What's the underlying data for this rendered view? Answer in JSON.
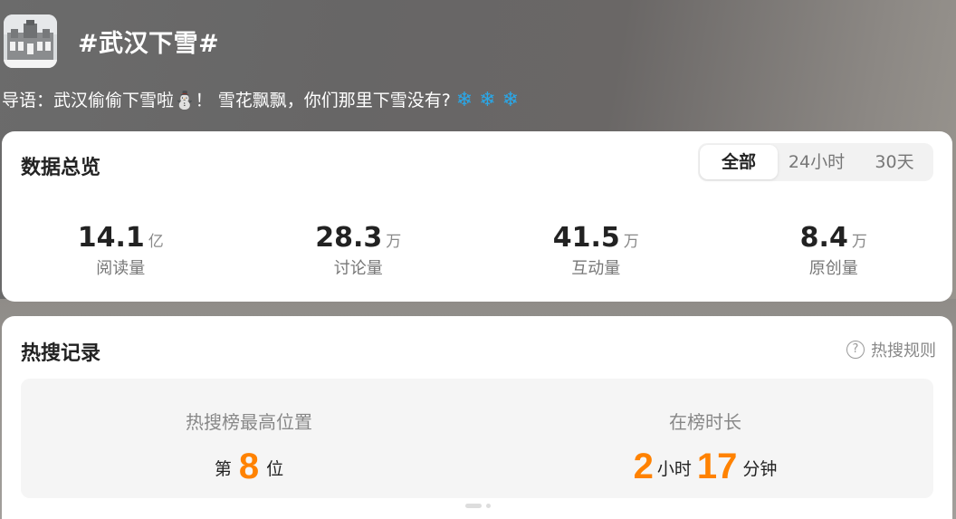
{
  "topic": {
    "title": "#武汉下雪#",
    "intro": "导语：武汉偷偷下雪啦⛄！ 雪花飘飘，你们那里下雪没有?",
    "snowflakes": "❄ ❄ ❄"
  },
  "overview": {
    "title": "数据总览",
    "tabs": [
      {
        "label": "全部",
        "active": true
      },
      {
        "label": "24小时",
        "active": false
      },
      {
        "label": "30天",
        "active": false
      }
    ],
    "stats": [
      {
        "value": "14.1",
        "unit": "亿",
        "label": "阅读量"
      },
      {
        "value": "28.3",
        "unit": "万",
        "label": "讨论量"
      },
      {
        "value": "41.5",
        "unit": "万",
        "label": "互动量"
      },
      {
        "value": "8.4",
        "unit": "万",
        "label": "原创量"
      }
    ]
  },
  "hot": {
    "title": "热搜记录",
    "rules_label": "热搜规则",
    "rules_icon": "?",
    "best_position": {
      "label": "热搜榜最高位置",
      "prefix": "第",
      "value": "8",
      "suffix": "位"
    },
    "duration": {
      "label": "在榜时长",
      "hours": "2",
      "hours_unit": "小时",
      "minutes": "17",
      "minutes_unit": "分钟"
    }
  },
  "colors": {
    "accent": "#ff8200",
    "snow": "#2aa7e8"
  }
}
